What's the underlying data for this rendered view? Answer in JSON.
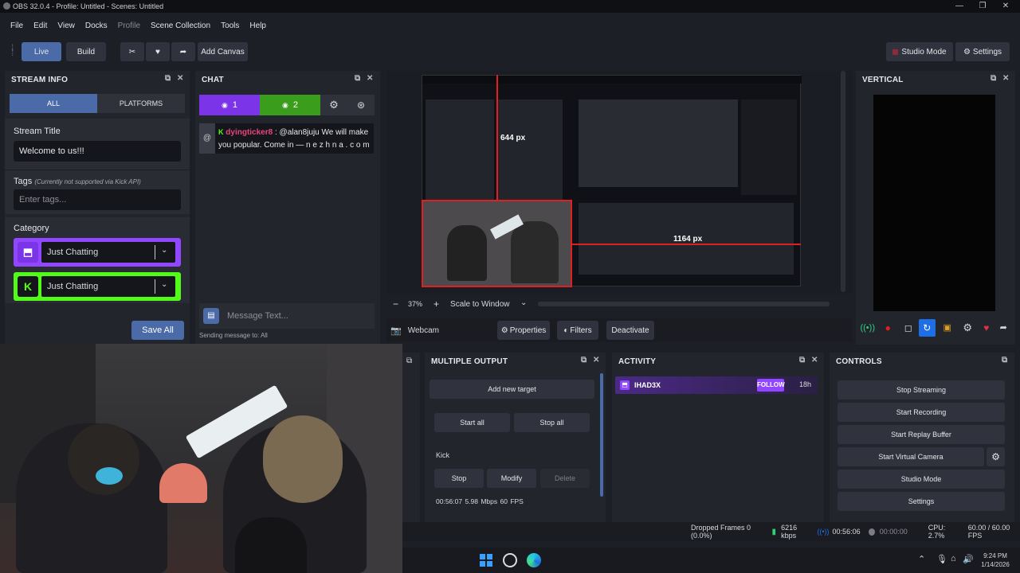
{
  "window": {
    "title": "OBS 32.0.4 - Profile: Untitled - Scenes: Untitled"
  },
  "menu": [
    "File",
    "Edit",
    "View",
    "Docks",
    "Profile",
    "Scene Collection",
    "Tools",
    "Help"
  ],
  "toolbar": {
    "live": "Live",
    "build": "Build",
    "add_canvas": "Add Canvas",
    "studio_mode": "Studio Mode",
    "settings": "Settings"
  },
  "stream_info": {
    "title": "STREAM INFO",
    "tab_all": "ALL",
    "tab_platforms": "PLATFORMS",
    "stream_title_label": "Stream Title",
    "stream_title_value": "Welcome to us!!!",
    "tags_label": "Tags",
    "tags_note": "(Currently not supported via Kick API)",
    "tags_placeholder": "Enter tags...",
    "category_label": "Category",
    "twitch_category": "Just Chatting",
    "kick_category": "Just Chatting",
    "save_all": "Save All"
  },
  "chat": {
    "title": "CHAT",
    "viewers_twitch": "1",
    "viewers_kick": "2",
    "message": {
      "user": "dyingticker8",
      "text": " : @alan8juju We will make you popular. Come in — n e z h n a . c o m"
    },
    "input_placeholder": "Message Text...",
    "sending_to": "Sending message to: All"
  },
  "preview": {
    "zoom": "37%",
    "scale_mode": "Scale to Window",
    "width_label": "1164 px",
    "height_label": "644 px"
  },
  "source_bar": {
    "source": "Webcam",
    "properties": "Properties",
    "filters": "Filters",
    "deactivate": "Deactivate"
  },
  "vertical": {
    "title": "VERTICAL"
  },
  "multiple_output": {
    "title": "MULTIPLE OUTPUT",
    "add_target": "Add new target",
    "start_all": "Start all",
    "stop_all": "Stop all",
    "target_name": "Kick",
    "stop": "Stop",
    "modify": "Modify",
    "delete": "Delete",
    "stats": "00:56:07  5.98 Mbps  60 FPS"
  },
  "activity": {
    "title": "ACTIVITY",
    "user": "IHAD3X",
    "action": "FOLLOW",
    "time": "18h"
  },
  "controls": {
    "title": "CONTROLS",
    "stop_streaming": "Stop Streaming",
    "start_recording": "Start Recording",
    "start_replay": "Start Replay Buffer",
    "start_virtual": "Start Virtual Camera",
    "studio_mode": "Studio Mode",
    "settings": "Settings"
  },
  "status": {
    "dropped": "Dropped Frames 0 (0.0%)",
    "bitrate": "6216 kbps",
    "stream_time": "00:56:06",
    "rec_time": "00:00:00",
    "cpu": "CPU: 2.7%",
    "fps": "60.00 / 60.00 FPS"
  },
  "taskbar": {
    "time": "9:24 PM",
    "date": "1/14/2026"
  },
  "colors": {
    "accent": "#4a6aa8",
    "twitch": "#9146ff",
    "kick": "#53fc18",
    "record_red": "#e02020"
  }
}
